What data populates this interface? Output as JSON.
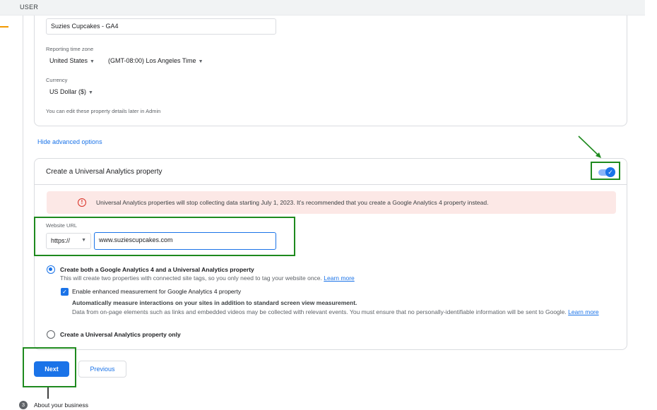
{
  "topbar": {
    "label": "USER"
  },
  "details": {
    "property_name": "Suzies Cupcakes - GA4",
    "timezone_label": "Reporting time zone",
    "country": "United States",
    "timezone": "(GMT-08:00) Los Angeles Time",
    "currency_label": "Currency",
    "currency": "US Dollar ($)",
    "hint": "You can edit these property details later in Admin"
  },
  "advanced_link": "Hide advanced options",
  "ua": {
    "title": "Create a Universal Analytics property",
    "toggle_on": true,
    "warning": "Universal Analytics properties will stop collecting data starting July 1, 2023. It’s recommended that you create a Google Analytics 4 property instead.",
    "url_label": "Website URL",
    "protocol": "https://",
    "url": "www.suziescupcakes.com",
    "option_both": {
      "title": "Create both a Google Analytics 4 and a Universal Analytics property",
      "desc": "This will create two properties with connected site tags, so you only need to tag your website once.",
      "learn_more": "Learn more"
    },
    "enhanced": {
      "label": "Enable enhanced measurement for Google Analytics 4 property",
      "bold": "Automatically measure interactions on your sites in addition to standard screen view measurement.",
      "desc": "Data from on-page elements such as links and embedded videos may be collected with relevant events. You must ensure that no personally-identifiable information will be sent to Google.",
      "learn_more": "Learn more"
    },
    "option_ua_only": "Create a Universal Analytics property only"
  },
  "buttons": {
    "next": "Next",
    "previous": "Previous"
  },
  "step3": {
    "number": "3",
    "label": "About your business"
  },
  "colors": {
    "accent": "#1a73e8",
    "annotation": "#1e8a1e",
    "warning_bg": "#fce8e6"
  }
}
